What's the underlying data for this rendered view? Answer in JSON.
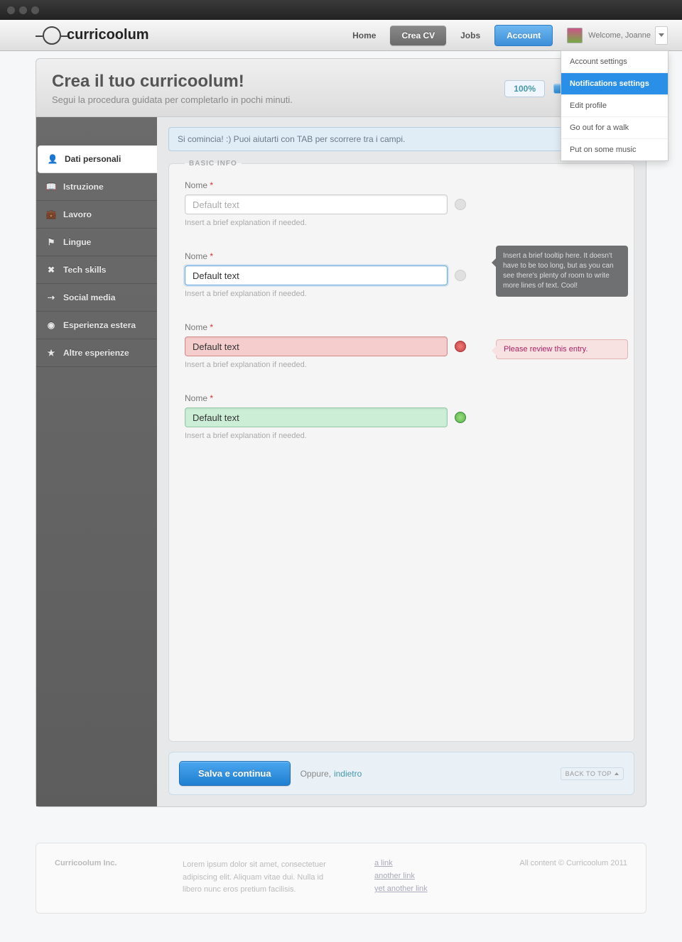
{
  "brand": "curricoolum",
  "nav": {
    "home": "Home",
    "create": "Crea CV",
    "jobs": "Jobs",
    "account": "Account"
  },
  "user": {
    "welcome": "Welcome, Joanne"
  },
  "dropdown": [
    "Account settings",
    "Notifications settings",
    "Edit profile",
    "Go out for a walk",
    "Put on some music"
  ],
  "header": {
    "title": "Crea il tuo curricoolum!",
    "subtitle": "Segui la procedura guidata per completarlo in pochi minuti.",
    "percent": "100%"
  },
  "sidebar": [
    {
      "icon": "👤",
      "label": "Dati personali"
    },
    {
      "icon": "📖",
      "label": "Istruzione"
    },
    {
      "icon": "💼",
      "label": "Lavoro"
    },
    {
      "icon": "⚑",
      "label": "Lingue"
    },
    {
      "icon": "✖",
      "label": "Tech skills"
    },
    {
      "icon": "⇢",
      "label": "Social media"
    },
    {
      "icon": "◉",
      "label": "Esperienza estera"
    },
    {
      "icon": "★",
      "label": "Altre esperienze"
    }
  ],
  "info_bar": "Si comincia! :) Puoi aiutarti con TAB per scorrere tra i campi.",
  "fieldset_legend": "BASIC INFO",
  "fields": {
    "label": "Nome",
    "required": "*",
    "placeholder": "Default text",
    "value": "Default text",
    "hint": "Insert a brief explanation if needed.",
    "tooltip": "Insert a brief tooltip here. It doesn't have to be too long, but as you can see there's plenty of room to write more lines of text. Cool!",
    "error_msg": "Please review this entry."
  },
  "actions": {
    "save": "Salva e continua",
    "or": "Oppure,",
    "back": "indietro",
    "top": "BACK TO TOP"
  },
  "footer": {
    "company": "Curricoolum Inc.",
    "blurb": "Lorem ipsum dolor sit amet, consectetuer adipiscing elit. Aliquam vitae dui. Nulla id libero nunc eros pretium facilisis.",
    "links": [
      "a link",
      "another link",
      "yet another link"
    ],
    "copyright": "All content © Curricoolum 2011"
  }
}
